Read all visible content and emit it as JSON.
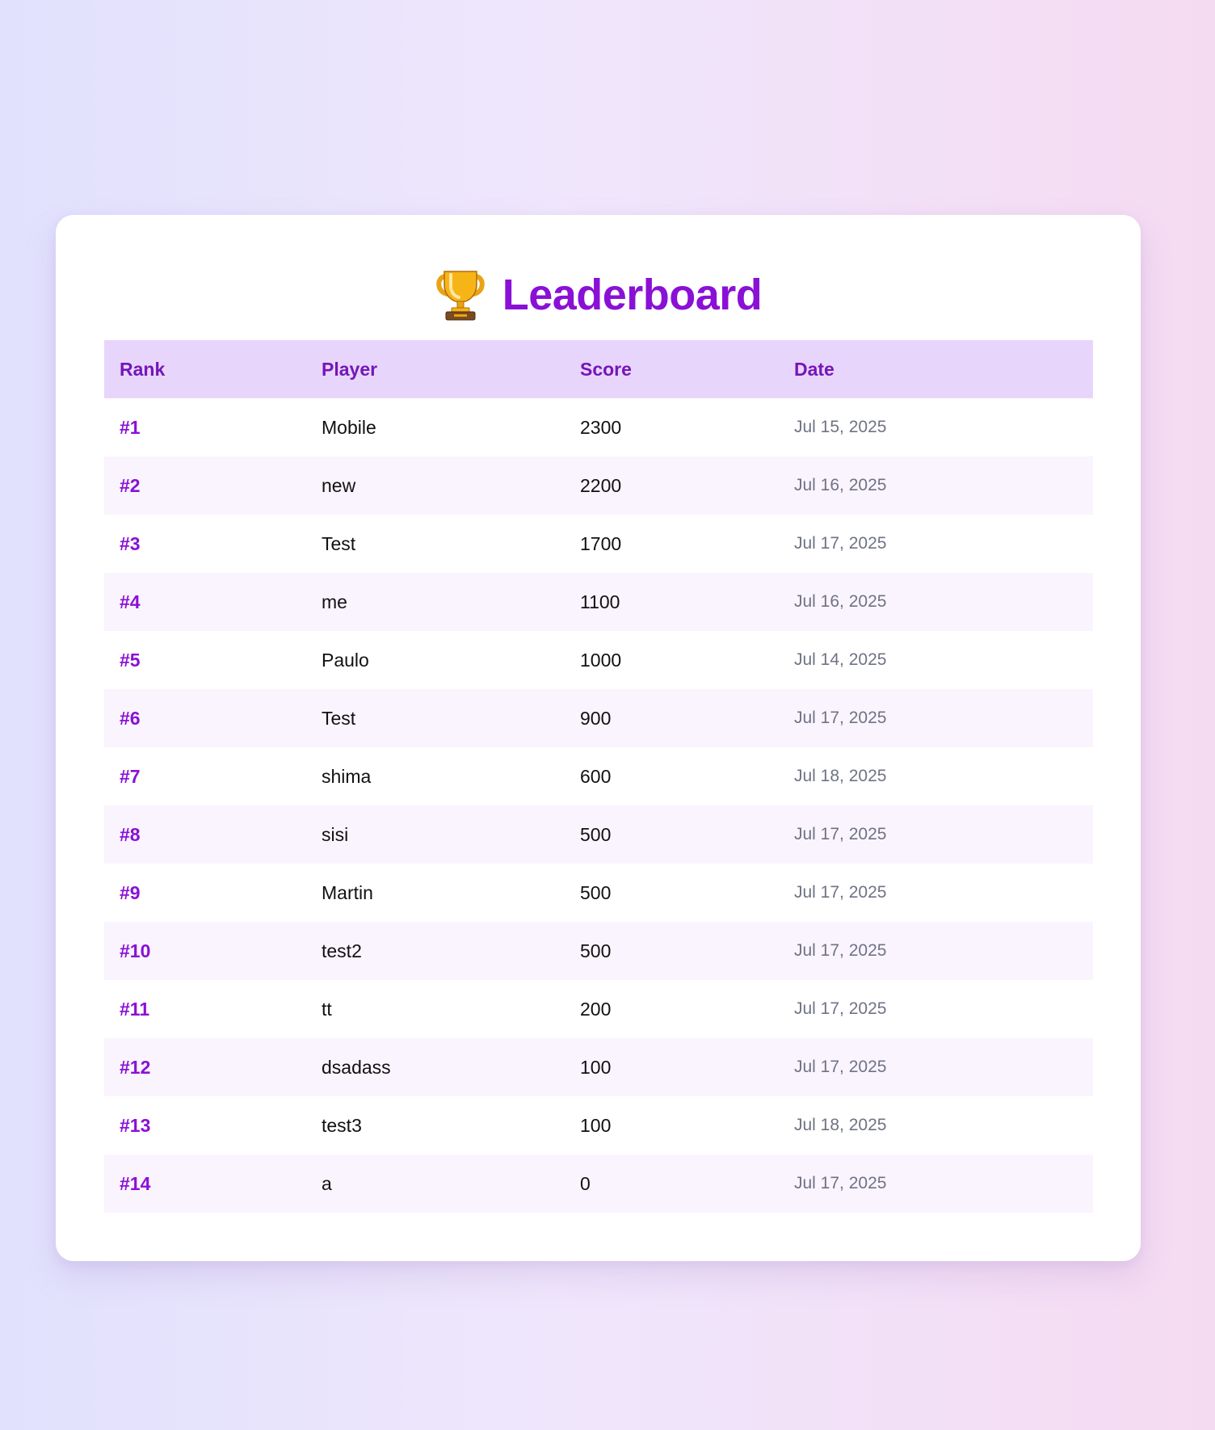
{
  "header": {
    "title": "Leaderboard",
    "icon": "trophy-icon"
  },
  "table": {
    "columns": [
      "Rank",
      "Player",
      "Score",
      "Date"
    ],
    "rows": [
      {
        "rank": "#1",
        "player": "Mobile",
        "score": "2300",
        "date": "Jul 15, 2025"
      },
      {
        "rank": "#2",
        "player": "new",
        "score": "2200",
        "date": "Jul 16, 2025"
      },
      {
        "rank": "#3",
        "player": "Test",
        "score": "1700",
        "date": "Jul 17, 2025"
      },
      {
        "rank": "#4",
        "player": "me",
        "score": "1100",
        "date": "Jul 16, 2025"
      },
      {
        "rank": "#5",
        "player": "Paulo",
        "score": "1000",
        "date": "Jul 14, 2025"
      },
      {
        "rank": "#6",
        "player": "Test",
        "score": "900",
        "date": "Jul 17, 2025"
      },
      {
        "rank": "#7",
        "player": "shima",
        "score": "600",
        "date": "Jul 18, 2025"
      },
      {
        "rank": "#8",
        "player": "sisi",
        "score": "500",
        "date": "Jul 17, 2025"
      },
      {
        "rank": "#9",
        "player": "Martin",
        "score": "500",
        "date": "Jul 17, 2025"
      },
      {
        "rank": "#10",
        "player": "test2",
        "score": "500",
        "date": "Jul 17, 2025"
      },
      {
        "rank": "#11",
        "player": "tt",
        "score": "200",
        "date": "Jul 17, 2025"
      },
      {
        "rank": "#12",
        "player": "dsadass",
        "score": "100",
        "date": "Jul 17, 2025"
      },
      {
        "rank": "#13",
        "player": "test3",
        "score": "100",
        "date": "Jul 18, 2025"
      },
      {
        "rank": "#14",
        "player": "a",
        "score": "0",
        "date": "Jul 17, 2025"
      }
    ]
  },
  "colors": {
    "accent": "#8a10d6",
    "header_bg": "#e8d5fc",
    "header_text": "#7416b8",
    "stripe": "#faf4fe",
    "date_text": "#6f7384"
  }
}
